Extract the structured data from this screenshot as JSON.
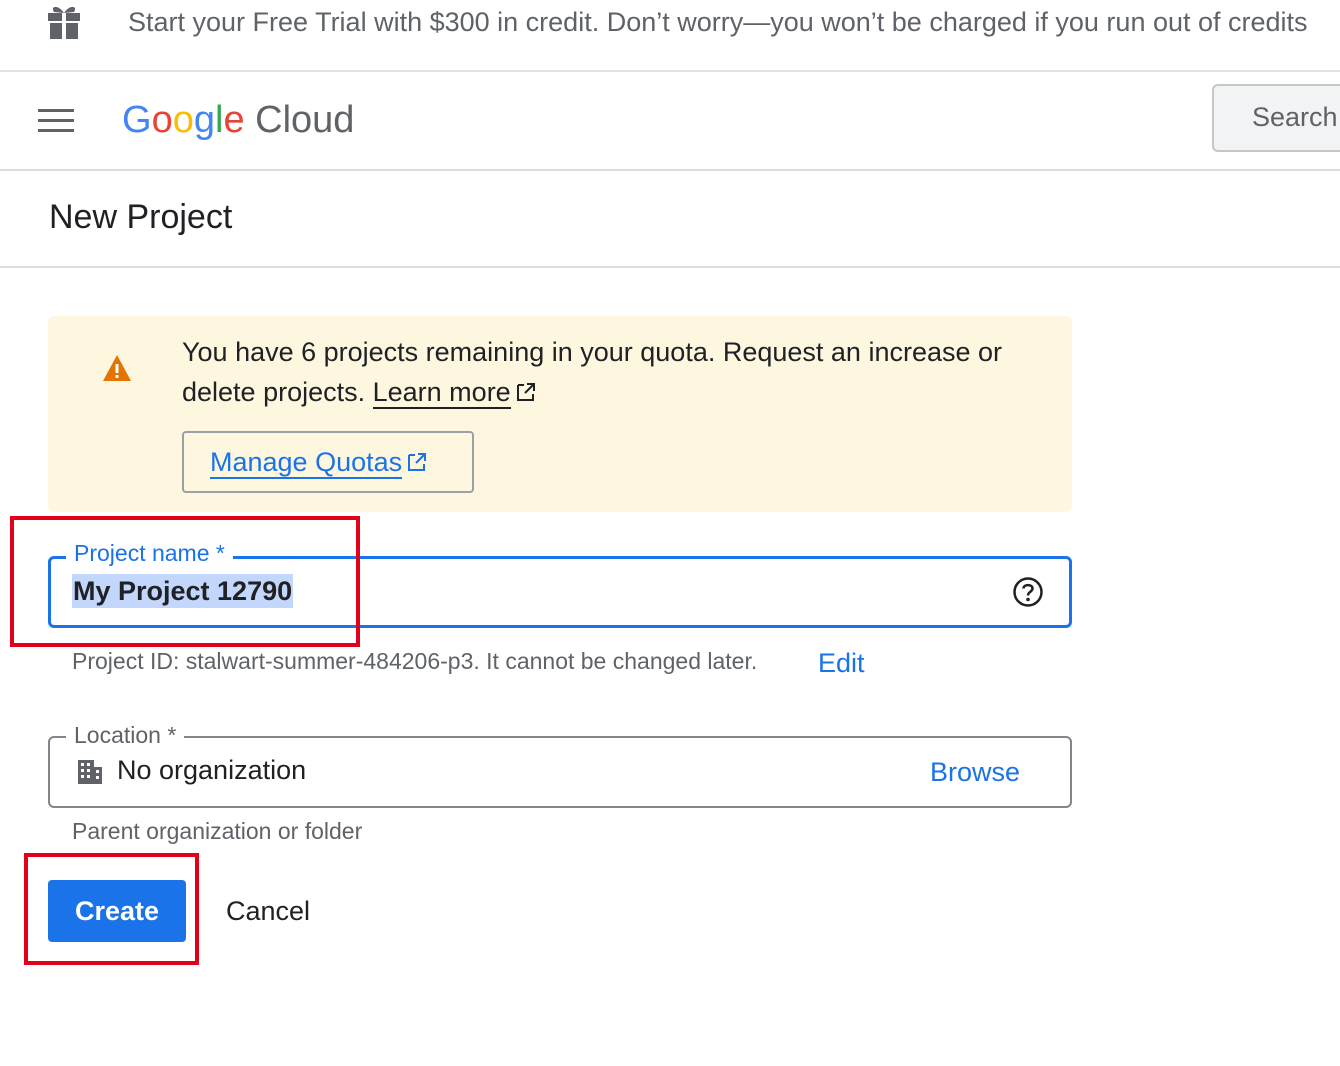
{
  "promo": {
    "text": "Start your Free Trial with $300 in credit. Don’t worry—you won’t be charged if you run out of credits"
  },
  "header": {
    "logo": {
      "g1": "G",
      "o1": "o",
      "o2": "o",
      "g2": "g",
      "l": "l",
      "e": "e",
      "cloud": "Cloud"
    },
    "search_label": "Search"
  },
  "page": {
    "title": "New Project"
  },
  "warning": {
    "text": "You have 6 projects remaining in your quota. Request an increase or delete projects.",
    "learn_more": "Learn more",
    "manage_quotas": "Manage Quotas"
  },
  "form": {
    "project_name_label": "Project name *",
    "project_name_value": "My Project 12790",
    "project_id_text": "Project ID: stalwart-summer-484206-p3. It cannot be changed later.",
    "edit_label": "Edit",
    "location_label": "Location *",
    "location_value": "No organization",
    "browse_label": "Browse",
    "location_hint": "Parent organization or folder"
  },
  "actions": {
    "create": "Create",
    "cancel": "Cancel"
  },
  "colors": {
    "accent": "#1a73e8",
    "warning_bg": "#fef7e0",
    "warning_icon": "#e37400",
    "highlight": "#e3001b"
  },
  "icons": [
    "gift-icon",
    "menu-icon",
    "warning-icon",
    "external-link-icon",
    "help-icon",
    "building-icon"
  ]
}
